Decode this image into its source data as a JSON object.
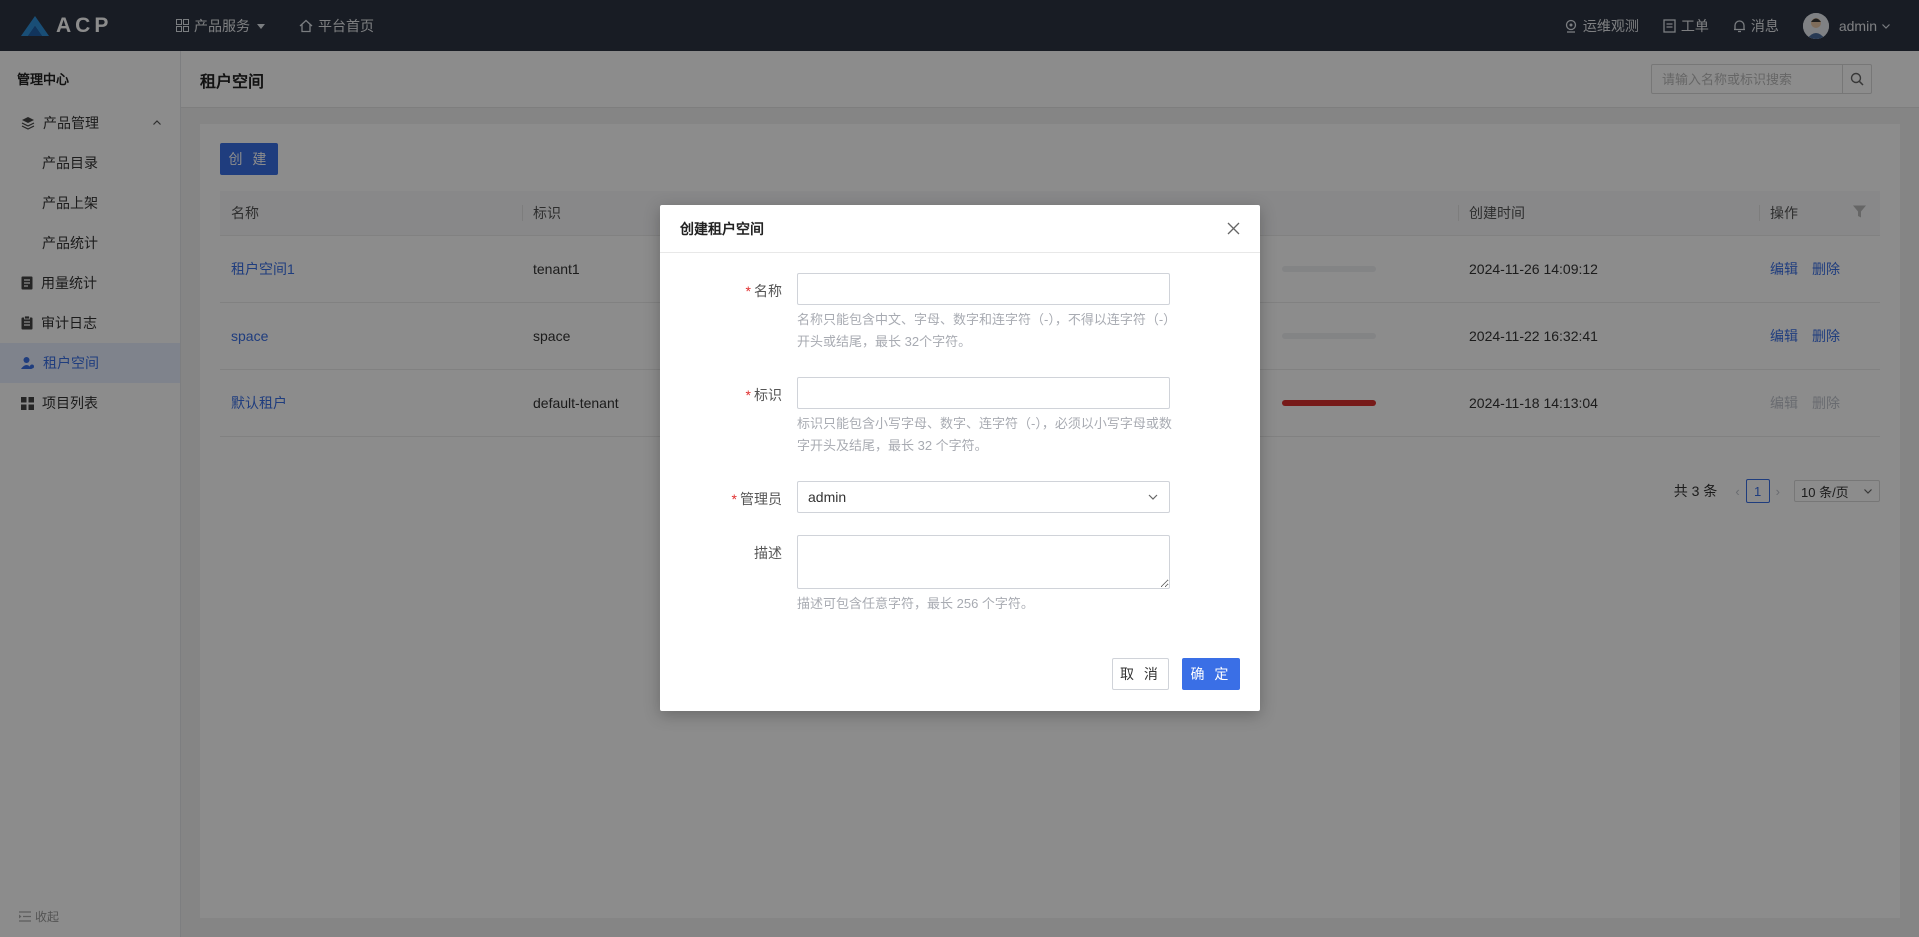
{
  "topbar": {
    "logo_text": "ACP",
    "nav": [
      {
        "label": "产品服务",
        "icon": "grid-icon"
      },
      {
        "label": "平台首页",
        "icon": "home-icon"
      }
    ],
    "right": [
      {
        "label": "运维观测",
        "icon": "monitor-icon"
      },
      {
        "label": "工单",
        "icon": "ticket-icon"
      },
      {
        "label": "消息",
        "icon": "bell-icon"
      }
    ],
    "user": "admin"
  },
  "sidebar": {
    "title": "管理中心",
    "group": {
      "label": "产品管理",
      "items": [
        "产品目录",
        "产品上架",
        "产品统计"
      ]
    },
    "items": [
      {
        "label": "用量统计",
        "icon": "document-icon"
      },
      {
        "label": "审计日志",
        "icon": "clipboard-icon"
      },
      {
        "label": "租户空间",
        "icon": "user-group-icon",
        "active": true
      },
      {
        "label": "项目列表",
        "icon": "grid-icon"
      }
    ],
    "collapse": "收起"
  },
  "page": {
    "title": "租户空间",
    "search_placeholder": "请输入名称或标识搜索",
    "create": "创 建",
    "columns": [
      "名称",
      "标识",
      "创建时间",
      "操作"
    ],
    "rows": [
      {
        "name": "租户空间1",
        "id": "tenant1",
        "created": "2024-11-26 14:09:12",
        "usage": 0.0,
        "edit": "编辑",
        "delete": "删除",
        "disabled": false
      },
      {
        "name": "space",
        "id": "space",
        "created": "2024-11-22 16:32:41",
        "usage": 0.0,
        "edit": "编辑",
        "delete": "删除",
        "disabled": false
      },
      {
        "name": "默认租户",
        "id": "default-tenant",
        "created": "2024-11-18 14:13:04",
        "usage": 1.0,
        "edit": "编辑",
        "delete": "删除",
        "disabled": true
      }
    ],
    "pagination": {
      "total": "共 3 条",
      "current": "1",
      "page_size": "10 条/页"
    }
  },
  "modal": {
    "title": "创建租户空间",
    "fields": {
      "name": {
        "label": "名称",
        "value": "",
        "hint": "名称只能包含中文、字母、数字和连字符（-），不得以连字符（-）开头或结尾，最长 32个字符。"
      },
      "identifier": {
        "label": "标识",
        "value": "",
        "hint": "标识只能包含小写字母、数字、连字符（-），必须以小写字母或数字开头及结尾，最长 32 个字符。"
      },
      "admin": {
        "label": "管理员",
        "value": "admin"
      },
      "description": {
        "label": "描述",
        "value": "",
        "hint": "描述可包含任意字符，最长 256 个字符。"
      }
    },
    "cancel": "取 消",
    "confirm": "确 定"
  },
  "colors": {
    "topbar": "#2c3443",
    "primary": "#3a6fe6",
    "danger": "#d9312f",
    "required": "#e02e2e"
  }
}
